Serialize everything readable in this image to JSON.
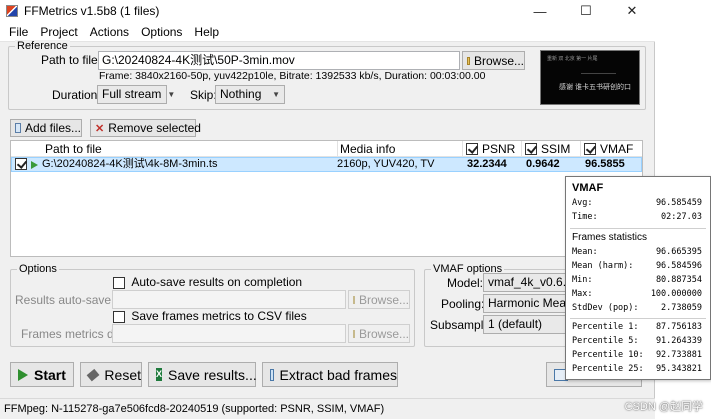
{
  "window": {
    "title": "FFMetrics v1.5b8 (1 files)"
  },
  "menu": [
    "File",
    "Project",
    "Actions",
    "Options",
    "Help"
  ],
  "reference": {
    "group_title": "Reference",
    "path_label": "Path to file:",
    "path_value": "G:\\20240824-4K测试\\50P-3min.mov",
    "browse_label": "Browse...",
    "info": "Frame: 3840x2160-50p, yuv422p10le, Bitrate: 1392533 kb/s, Duration: 00:03:00.00",
    "duration_label": "Duration:",
    "duration_value": "Full stream",
    "skip_label": "Skip:",
    "skip_value": "Nothing",
    "thumb_caption": "感谢 谁卡五书研创的口",
    "thumb_topline": "重新 双 北京 第一 片尾"
  },
  "toolbar": {
    "add_label": "Add files...",
    "remove_label": "Remove selected"
  },
  "file_list": {
    "headers": {
      "path": "Path to file",
      "media": "Media info",
      "psnr": "PSNR",
      "ssim": "SSIM",
      "vmaf": "VMAF"
    },
    "rows": [
      {
        "path": "G:\\20240824-4K测试\\4k-8M-3min.ts",
        "media": "2160p, YUV420, TV",
        "psnr": "32.2344",
        "ssim": "0.9642",
        "vmaf": "96.5855"
      }
    ]
  },
  "options": {
    "group_title": "Options",
    "autosave_check": "Auto-save results on completion",
    "autosave_dir_label": "Results auto-save fil",
    "browse_label": "Browse...",
    "frames_check": "Save frames metrics to CSV files",
    "frames_dir_label": "Frames metrics dir:"
  },
  "vmaf_options": {
    "group_title": "VMAF options",
    "model_label": "Model:",
    "model_value": "vmaf_4k_v0.6.1",
    "pooling_label": "Pooling:",
    "pooling_value": "Harmonic Mean",
    "subsample_label": "Subsample",
    "subsample_value": "1 (default)"
  },
  "actions": {
    "start": "Start",
    "reset": "Reset",
    "save": "Save results...",
    "extract": "Extract bad frames"
  },
  "status": "FFMpeg: N-115278-ga7e506fcd8-20240519 (supported: PSNR, SSIM, VMAF)",
  "tooltip": {
    "title": "VMAF",
    "summary": [
      {
        "k": "Avg:",
        "v": "96.585459"
      },
      {
        "k": "Time:",
        "v": "02:27.03"
      }
    ],
    "section": "Frames statistics",
    "stats": [
      {
        "k": "Mean:",
        "v": "96.665395"
      },
      {
        "k": "Mean (harm):",
        "v": "96.584596"
      },
      {
        "k": "Min:",
        "v": "80.887354"
      },
      {
        "k": "Max:",
        "v": "100.000000"
      },
      {
        "k": "StdDev (pop):",
        "v": "2.738059"
      }
    ],
    "percentiles": [
      {
        "k": "Percentile 1:",
        "v": "87.756183"
      },
      {
        "k": "Percentile 5:",
        "v": "91.264339"
      },
      {
        "k": "Percentile 10:",
        "v": "92.733881"
      },
      {
        "k": "Percentile 25:",
        "v": "95.343821"
      }
    ]
  },
  "watermark": "CSDN @赵同学"
}
